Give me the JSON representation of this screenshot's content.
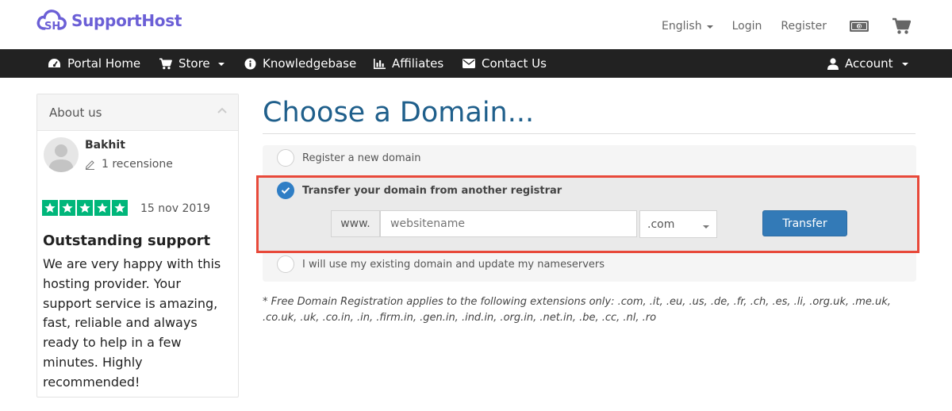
{
  "header": {
    "brand": "SupportHost",
    "language": "English",
    "login": "Login",
    "register": "Register",
    "cash_icon": "cash-icon",
    "cart_icon": "cart-icon"
  },
  "nav": {
    "items": [
      {
        "label": "Portal Home",
        "icon": "dashboard-icon"
      },
      {
        "label": "Store",
        "icon": "cart-icon",
        "dropdown": true
      },
      {
        "label": "Knowledgebase",
        "icon": "info-icon"
      },
      {
        "label": "Affiliates",
        "icon": "bar-chart-icon"
      },
      {
        "label": "Contact Us",
        "icon": "envelope-icon"
      }
    ],
    "account": {
      "label": "Account",
      "icon": "user-icon",
      "dropdown": true
    }
  },
  "sidebar": {
    "title": "About us",
    "review": {
      "name": "Bakhit",
      "count": "1 recensione",
      "stars": 5,
      "date": "15 nov 2019",
      "title": "Outstanding support",
      "body": "We are very happy with this hosting provider. Your support service is amazing, fast, reliable and always ready to help in a few minutes. Highly recommended!"
    }
  },
  "main": {
    "title": "Choose a Domain...",
    "options": [
      {
        "label": "Register a new domain",
        "selected": false
      },
      {
        "label": "Transfer your domain from another registrar",
        "selected": true
      },
      {
        "label": "I will use my existing domain and update my nameservers",
        "selected": false
      }
    ],
    "www_prefix": "www.",
    "domain_placeholder": "websitename",
    "tld_selected": ".com",
    "transfer_button": "Transfer",
    "note": "* Free Domain Registration applies to the following extensions only: .com, .it, .eu, .us, .de, .fr, .ch, .es, .li, .org.uk, .me.uk, .co.uk, .uk, .co.in, .in, .firm.in, .gen.in, .ind.in, .org.in, .net.in, .be, .cc, .nl, .ro"
  },
  "colors": {
    "brand": "#6b5fd6",
    "navbar": "#222222",
    "title": "#1f5f8b",
    "primary": "#337ab7",
    "highlight_border": "#e8493a",
    "trustpilot": "#00b67a"
  }
}
